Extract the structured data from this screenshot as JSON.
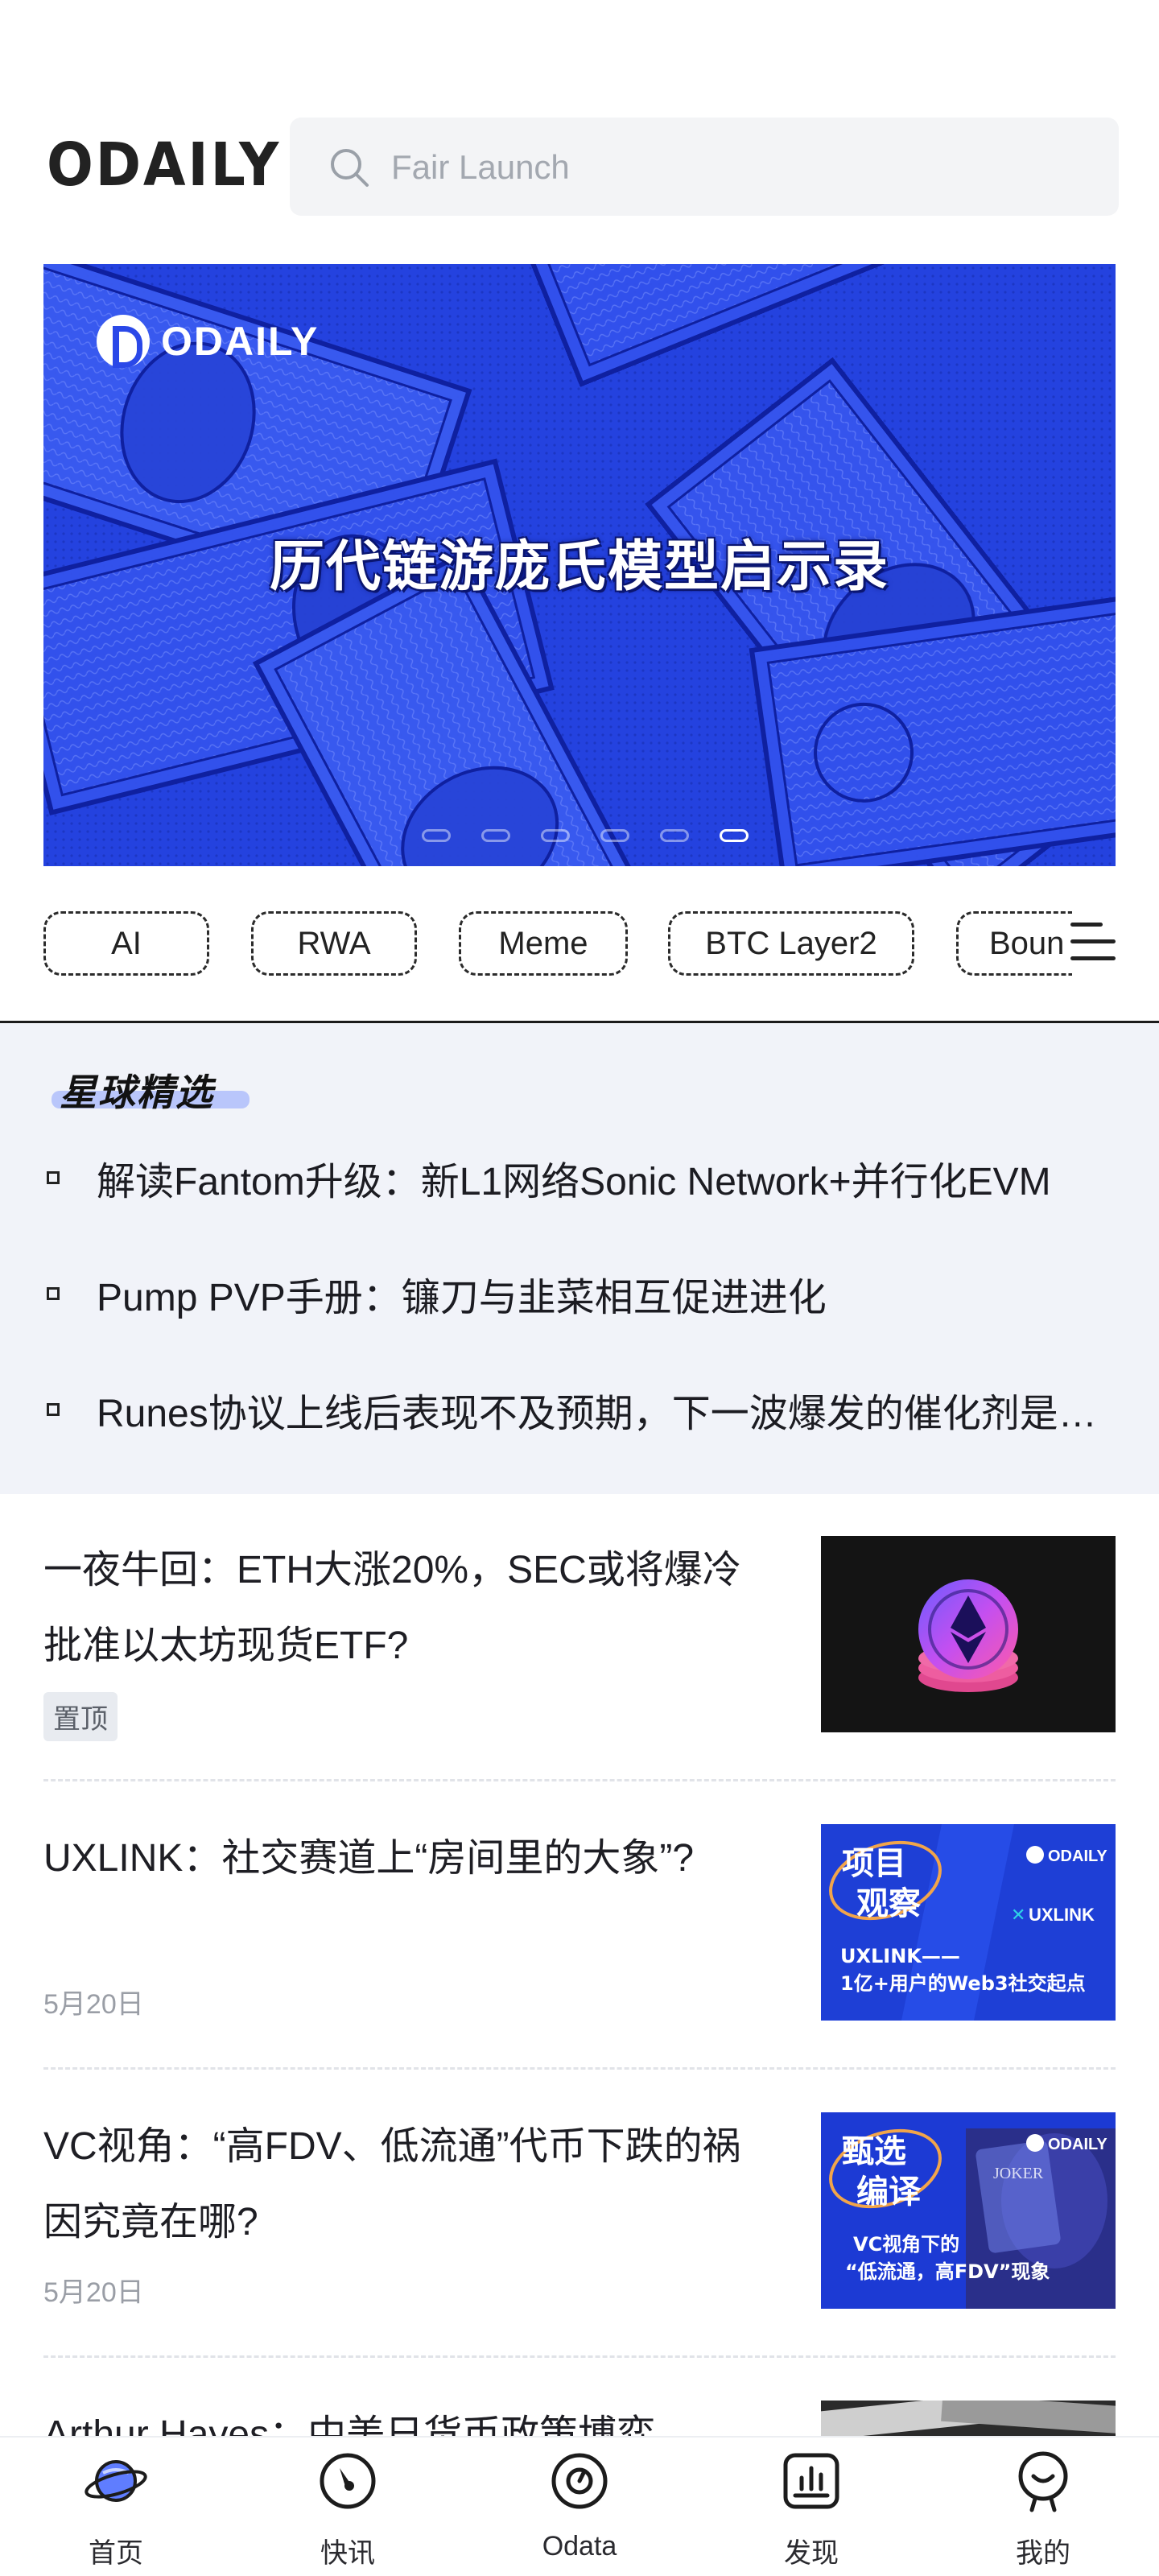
{
  "header": {
    "logo": "ODAILY",
    "search_placeholder": "Fair Launch"
  },
  "banner": {
    "brand": "ODAILY",
    "title": "历代链游庞氏模型启示录",
    "slide_count": 6,
    "active_slide": 6
  },
  "tags": [
    "AI",
    "RWA",
    "Meme",
    "BTC Layer2",
    "Boun"
  ],
  "featured": {
    "title": "星球精选",
    "items": [
      "解读Fantom升级：新L1网络Sonic Network+并行化EVM",
      "Pump PVP手册：镰刀与韭菜相互促进进化",
      "Runes协议上线后表现不及预期，下一波爆发的催化剂是什么？"
    ]
  },
  "articles": [
    {
      "title": "一夜牛回：ETH大涨20%，SEC或将爆冷批准以太坊现货ETF?",
      "badge": "置顶",
      "date": ""
    },
    {
      "title": "UXLINK：社交赛道上“房间里的大象”?",
      "badge": "",
      "date": "5月20日",
      "thumb_text": {
        "tag1": "项目",
        "tag2": "观察",
        "brand": "ODAILY",
        "partner": "UXLINK",
        "line1": "UXLINK——",
        "line2": "1亿+用户的Web3社交起点"
      }
    },
    {
      "title": "VC视角：“高FDV、低流通”代币下跌的祸因究竟在哪?",
      "badge": "",
      "date": "5月20日",
      "thumb_text": {
        "tag1": "甄选",
        "tag2": "编译",
        "brand": "ODAILY",
        "card": "JOKER",
        "line1": "VC视角下的",
        "line2": "“低流通，高FDV”现象"
      }
    },
    {
      "title": "Arthur Hayes：中美日货币政策博弈",
      "badge": "",
      "date": ""
    }
  ],
  "bottom_nav": [
    {
      "label": "首页",
      "icon": "planet-icon"
    },
    {
      "label": "快讯",
      "icon": "flash-clock-icon"
    },
    {
      "label": "Odata",
      "icon": "odata-icon"
    },
    {
      "label": "发现",
      "icon": "chart-icon"
    },
    {
      "label": "我的",
      "icon": "profile-icon"
    }
  ],
  "colors": {
    "banner_blue": "#2a48e8",
    "featured_bg": "#f1f3f9",
    "accent_underline": "#b9c6fb",
    "thumb_blue": "#1e3fd6"
  }
}
